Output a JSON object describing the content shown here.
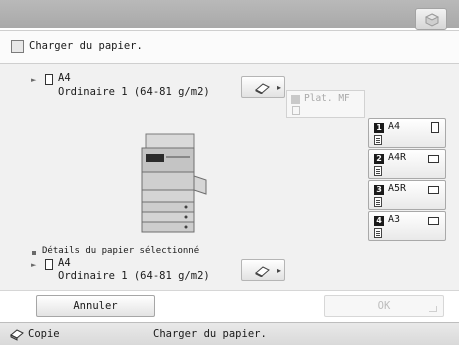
{
  "message": "Charger du papier.",
  "current_paper": {
    "size": "A4",
    "type": "Ordinaire 1 (64-81 g/m2)"
  },
  "multipurpose_tray": {
    "label": "Plat. MF"
  },
  "drawers": [
    {
      "number": "1",
      "label": "A4",
      "orientation": "portrait"
    },
    {
      "number": "2",
      "label": "A4R",
      "orientation": "landscape"
    },
    {
      "number": "3",
      "label": "A5R",
      "orientation": "landscape"
    },
    {
      "number": "4",
      "label": "A3",
      "orientation": "landscape"
    }
  ],
  "selected_details": {
    "heading": "Détails du papier sélectionné",
    "size": "A4",
    "type": "Ordinaire 1 (64-81 g/m2)"
  },
  "buttons": {
    "cancel": "Annuler",
    "ok": "OK"
  },
  "status": {
    "function": "Copie",
    "message": "Charger du papier."
  }
}
